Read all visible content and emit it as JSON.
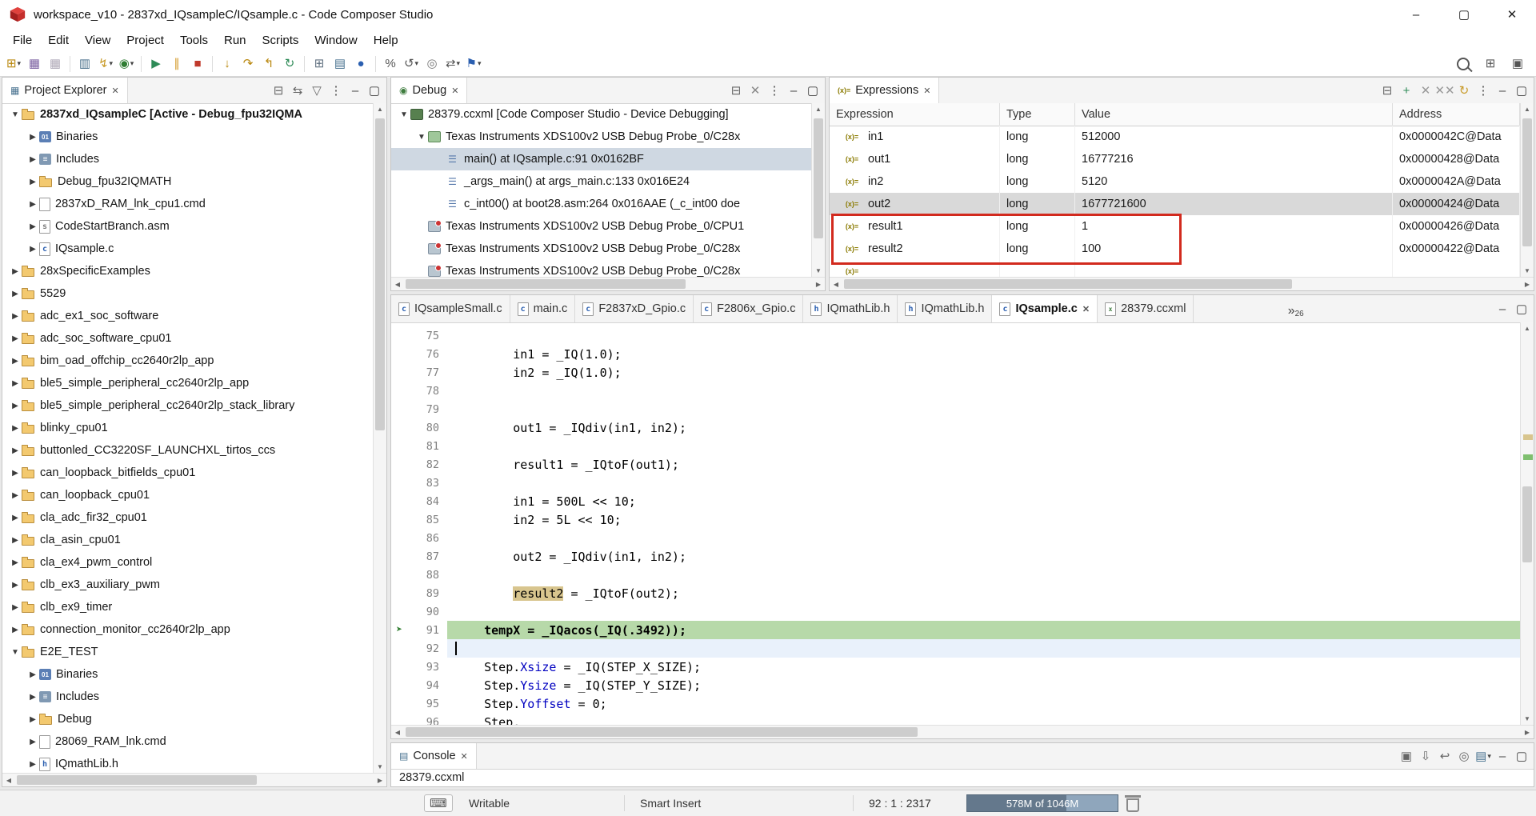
{
  "window": {
    "title": "workspace_v10 - 2837xd_IQsampleC/IQsample.c - Code Composer Studio",
    "controls": {
      "minimize": "–",
      "maximize": "▢",
      "close": "✕"
    }
  },
  "menubar": {
    "items": [
      "File",
      "Edit",
      "View",
      "Project",
      "Tools",
      "Run",
      "Scripts",
      "Window",
      "Help"
    ]
  },
  "toolbar": {
    "left": [
      {
        "name": "new",
        "glyph": "⊞",
        "color": "#b8860b",
        "dropdown": true
      },
      {
        "name": "save",
        "glyph": "▦",
        "color": "#7a5fa0"
      },
      {
        "name": "save-all",
        "glyph": "▦",
        "color": "#b0aab8"
      },
      {
        "sep": true
      },
      {
        "name": "new-target-configuration",
        "glyph": "▥",
        "color": "#4a708b"
      },
      {
        "name": "flash",
        "glyph": "↯",
        "color": "#c89b2a",
        "dropdown": true
      },
      {
        "name": "debug",
        "glyph": "◉",
        "color": "#2e7d32",
        "dropdown": true
      },
      {
        "sep": true
      },
      {
        "name": "resume",
        "glyph": "▶",
        "color": "#2e8b57"
      },
      {
        "name": "suspend",
        "glyph": "∥",
        "color": "#d49a2a"
      },
      {
        "name": "terminate",
        "glyph": "■",
        "color": "#c0392b"
      },
      {
        "sep": true
      },
      {
        "name": "step-into",
        "glyph": "↓",
        "color": "#b8860b"
      },
      {
        "name": "step-over",
        "glyph": "↷",
        "color": "#b8860b"
      },
      {
        "name": "step-return",
        "glyph": "↰",
        "color": "#b8860b"
      },
      {
        "name": "restart",
        "glyph": "↻",
        "color": "#2e8b57"
      },
      {
        "sep": true
      },
      {
        "name": "registers",
        "glyph": "⊞",
        "color": "#5f6f7f"
      },
      {
        "name": "memory-browser",
        "glyph": "▤",
        "color": "#46708e"
      },
      {
        "name": "breakpoints",
        "glyph": "●",
        "color": "#2b5fb0"
      },
      {
        "sep": true
      },
      {
        "name": "profile",
        "glyph": "%",
        "color": "#555555"
      },
      {
        "name": "reset-cpu",
        "glyph": "↺",
        "color": "#555555",
        "dropdown": true
      },
      {
        "name": "pin",
        "glyph": "◎",
        "color": "#777777"
      },
      {
        "name": "connect-target",
        "glyph": "⇄",
        "color": "#555555",
        "dropdown": true
      },
      {
        "name": "new-breakpoint",
        "glyph": "⚑",
        "color": "#2b5fb0",
        "dropdown": true
      }
    ],
    "right": [
      {
        "name": "search",
        "mag": true
      },
      {
        "name": "open-perspective",
        "glyph": "⊞",
        "color": "#555555"
      },
      {
        "name": "ccs-debug-perspective",
        "glyph": "▣",
        "color": "#555555"
      }
    ]
  },
  "project_explorer": {
    "title": "Project Explorer",
    "tab_glyph": "▦",
    "header_icons": [
      {
        "name": "collapse-all",
        "glyph": "⊟",
        "color": "#666666"
      },
      {
        "name": "link-with-editor",
        "glyph": "⇆",
        "color": "#666666"
      },
      {
        "name": "filter",
        "glyph": "▽",
        "color": "#666666"
      },
      {
        "name": "view-menu",
        "glyph": "⋮",
        "color": "#444444"
      },
      {
        "name": "minimize",
        "glyph": "–",
        "color": "#444444"
      },
      {
        "name": "maximize",
        "glyph": "▢",
        "color": "#444444"
      }
    ],
    "items": [
      {
        "label": "2837xd_IQsampleC  [Active - Debug_fpu32IQMA",
        "depth": 0,
        "state": "open",
        "icon": "project",
        "bold": true
      },
      {
        "label": "Binaries",
        "depth": 1,
        "state": "closed",
        "icon": "binaries"
      },
      {
        "label": "Includes",
        "depth": 1,
        "state": "closed",
        "icon": "includes"
      },
      {
        "label": "Debug_fpu32IQMATH",
        "depth": 1,
        "state": "closed",
        "icon": "folder"
      },
      {
        "label": "2837xD_RAM_lnk_cpu1.cmd",
        "depth": 1,
        "state": "closed",
        "icon": "cmdfile"
      },
      {
        "label": "CodeStartBranch.asm",
        "depth": 1,
        "state": "closed",
        "icon": "asmfile"
      },
      {
        "label": "IQsample.c",
        "depth": 1,
        "state": "closed",
        "icon": "cfile"
      },
      {
        "label": "28xSpecificExamples",
        "depth": 0,
        "state": "closed",
        "icon": "project"
      },
      {
        "label": "5529",
        "depth": 0,
        "state": "closed",
        "icon": "project"
      },
      {
        "label": "adc_ex1_soc_software",
        "depth": 0,
        "state": "closed",
        "icon": "project"
      },
      {
        "label": "adc_soc_software_cpu01",
        "depth": 0,
        "state": "closed",
        "icon": "project"
      },
      {
        "label": "bim_oad_offchip_cc2640r2lp_app",
        "depth": 0,
        "state": "closed",
        "icon": "project"
      },
      {
        "label": "ble5_simple_peripheral_cc2640r2lp_app",
        "depth": 0,
        "state": "closed",
        "icon": "project"
      },
      {
        "label": "ble5_simple_peripheral_cc2640r2lp_stack_library",
        "depth": 0,
        "state": "closed",
        "icon": "project"
      },
      {
        "label": "blinky_cpu01",
        "depth": 0,
        "state": "closed",
        "icon": "project"
      },
      {
        "label": "buttonled_CC3220SF_LAUNCHXL_tirtos_ccs",
        "depth": 0,
        "state": "closed",
        "icon": "project"
      },
      {
        "label": "can_loopback_bitfields_cpu01",
        "depth": 0,
        "state": "closed",
        "icon": "project"
      },
      {
        "label": "can_loopback_cpu01",
        "depth": 0,
        "state": "closed",
        "icon": "project"
      },
      {
        "label": "cla_adc_fir32_cpu01",
        "depth": 0,
        "state": "closed",
        "icon": "project"
      },
      {
        "label": "cla_asin_cpu01",
        "depth": 0,
        "state": "closed",
        "icon": "project"
      },
      {
        "label": "cla_ex4_pwm_control",
        "depth": 0,
        "state": "closed",
        "icon": "project"
      },
      {
        "label": "clb_ex3_auxiliary_pwm",
        "depth": 0,
        "state": "closed",
        "icon": "project"
      },
      {
        "label": "clb_ex9_timer",
        "depth": 0,
        "state": "closed",
        "icon": "project"
      },
      {
        "label": "connection_monitor_cc2640r2lp_app",
        "depth": 0,
        "state": "closed",
        "icon": "project"
      },
      {
        "label": "E2E_TEST",
        "depth": 0,
        "state": "open",
        "icon": "project"
      },
      {
        "label": "Binaries",
        "depth": 1,
        "state": "closed",
        "icon": "binaries"
      },
      {
        "label": "Includes",
        "depth": 1,
        "state": "closed",
        "icon": "includes"
      },
      {
        "label": "Debug",
        "depth": 1,
        "state": "closed",
        "icon": "folder"
      },
      {
        "label": "28069_RAM_lnk.cmd",
        "depth": 1,
        "state": "closed",
        "icon": "cmdfile"
      },
      {
        "label": "IQmathLib.h",
        "depth": 1,
        "state": "closed",
        "icon": "hfile"
      }
    ]
  },
  "debug_panel": {
    "title": "Debug",
    "tab_glyph": "◉",
    "header_icons": [
      {
        "name": "collapse-all",
        "glyph": "⊟",
        "color": "#666666"
      },
      {
        "name": "remove-all-terminated",
        "glyph": "✕",
        "color": "#888888"
      },
      {
        "name": "view-menu",
        "glyph": "⋮",
        "color": "#444444"
      },
      {
        "name": "minimize",
        "glyph": "–",
        "color": "#444444"
      },
      {
        "name": "maximize",
        "glyph": "▢",
        "color": "#444444"
      }
    ],
    "items": [
      {
        "label": "28379.ccxml [Code Composer Studio - Device Debugging]",
        "depth": 0,
        "state": "open",
        "icon": "target"
      },
      {
        "label": "Texas Instruments XDS100v2 USB Debug Probe_0/C28x",
        "depth": 1,
        "state": "open",
        "icon": "corerun"
      },
      {
        "label": "main() at IQsample.c:91 0x0162BF",
        "depth": 2,
        "icon": "frame",
        "selected": true
      },
      {
        "label": "_args_main() at args_main.c:133 0x016E24",
        "depth": 2,
        "icon": "frame"
      },
      {
        "label": "c_int00() at boot28.asm:264 0x016AAE (_c_int00 doe",
        "depth": 2,
        "icon": "frame"
      },
      {
        "label": "Texas Instruments XDS100v2 USB Debug Probe_0/CPU1",
        "depth": 1,
        "icon": "core"
      },
      {
        "label": "Texas Instruments XDS100v2 USB Debug Probe_0/C28x",
        "depth": 1,
        "icon": "core"
      },
      {
        "label": "Texas Instruments XDS100v2 USB Debug Probe_0/C28x",
        "depth": 1,
        "icon": "core"
      }
    ]
  },
  "expressions": {
    "title": "Expressions",
    "tab_glyph": "(x)=",
    "header_icons": [
      {
        "name": "collapse-all",
        "glyph": "⊟",
        "color": "#666666"
      },
      {
        "name": "add-expression",
        "glyph": "+",
        "color": "#2e8b57"
      },
      {
        "name": "remove-expression",
        "glyph": "✕",
        "color": "#999999"
      },
      {
        "name": "remove-all-expressions",
        "glyph": "✕✕",
        "color": "#999999"
      },
      {
        "name": "refresh",
        "glyph": "↻",
        "color": "#c89b2a"
      },
      {
        "name": "view-menu",
        "glyph": "⋮",
        "color": "#444444"
      },
      {
        "name": "minimize",
        "glyph": "–",
        "color": "#444444"
      },
      {
        "name": "maximize",
        "glyph": "▢",
        "color": "#444444"
      }
    ],
    "columns": [
      "Expression",
      "Type",
      "Value",
      "Address"
    ],
    "rows": [
      {
        "name": "in1",
        "type": "long",
        "value": "512000",
        "address": "0x0000042C@Data"
      },
      {
        "name": "out1",
        "type": "long",
        "value": "16777216",
        "address": "0x00000428@Data"
      },
      {
        "name": "in2",
        "type": "long",
        "value": "5120",
        "address": "0x0000042A@Data"
      },
      {
        "name": "out2",
        "type": "long",
        "value": "1677721600",
        "address": "0x00000424@Data",
        "selected": true
      },
      {
        "name": "result1",
        "type": "long",
        "value": "1",
        "address": "0x00000426@Data",
        "highlighted": true
      },
      {
        "name": "result2",
        "type": "long",
        "value": "100",
        "address": "0x00000422@Data",
        "highlighted": true
      }
    ]
  },
  "editor": {
    "hidden_count": "26",
    "header_icons": [
      {
        "name": "minimize",
        "glyph": "–",
        "color": "#444444"
      },
      {
        "name": "maximize",
        "glyph": "▢",
        "color": "#444444"
      }
    ],
    "tabs": [
      {
        "label": "IQsampleSmall.c",
        "icon": "cfile"
      },
      {
        "label": "main.c",
        "icon": "cfile"
      },
      {
        "label": "F2837xD_Gpio.c",
        "icon": "cfile"
      },
      {
        "label": "F2806x_Gpio.c",
        "icon": "cfile"
      },
      {
        "label": "IQmathLib.h",
        "icon": "hfile"
      },
      {
        "label": "IQmathLib.h",
        "icon": "hfile"
      },
      {
        "label": "IQsample.c",
        "icon": "cfile",
        "active": true
      },
      {
        "label": "28379.ccxml",
        "icon": "ccxml"
      }
    ],
    "lines": [
      {
        "num": "75",
        "segs": []
      },
      {
        "num": "76",
        "segs": [
          {
            "t": "        in1 = _IQ(1.0);"
          }
        ]
      },
      {
        "num": "77",
        "segs": [
          {
            "t": "        in2 = _IQ(1.0);"
          }
        ]
      },
      {
        "num": "78",
        "segs": []
      },
      {
        "num": "79",
        "segs": []
      },
      {
        "num": "80",
        "segs": [
          {
            "t": "        out1 = _IQdiv(in1, in2);"
          }
        ]
      },
      {
        "num": "81",
        "segs": []
      },
      {
        "num": "82",
        "segs": [
          {
            "t": "        result1 = _IQtoF(out1);"
          }
        ]
      },
      {
        "num": "83",
        "segs": []
      },
      {
        "num": "84",
        "segs": [
          {
            "t": "        in1 = 500L << 10;"
          }
        ]
      },
      {
        "num": "85",
        "segs": [
          {
            "t": "        in2 = 5L << 10;"
          }
        ]
      },
      {
        "num": "86",
        "segs": []
      },
      {
        "num": "87",
        "segs": [
          {
            "t": "        out2 = _IQdiv(in1, in2);"
          }
        ]
      },
      {
        "num": "88",
        "segs": []
      },
      {
        "num": "89",
        "segs": [
          {
            "t": "        "
          },
          {
            "t": "result2",
            "occ": true
          },
          {
            "t": " = _IQtoF(out2);"
          }
        ]
      },
      {
        "num": "90",
        "segs": []
      },
      {
        "num": "91",
        "hl": "debug",
        "pointer": true,
        "segs": [
          {
            "t": "    tempX = _IQacos(_IQ(.3492));"
          }
        ]
      },
      {
        "num": "92",
        "hl": "cursor",
        "segs": []
      },
      {
        "num": "93",
        "segs": [
          {
            "t": "    Step."
          },
          {
            "t": "Xsize",
            "c": "member"
          },
          {
            "t": " = _IQ(STEP_X_SIZE);"
          }
        ]
      },
      {
        "num": "94",
        "segs": [
          {
            "t": "    Step."
          },
          {
            "t": "Ysize",
            "c": "member"
          },
          {
            "t": " = _IQ(STEP_Y_SIZE);"
          }
        ]
      },
      {
        "num": "95",
        "segs": [
          {
            "t": "    Step."
          },
          {
            "t": "Yoffset",
            "c": "member"
          },
          {
            "t": " = 0;"
          }
        ]
      },
      {
        "num": "96",
        "segs": [
          {
            "t": "    Step."
          }
        ]
      }
    ]
  },
  "console": {
    "title": "Console",
    "tab_glyph": "▤",
    "content": "28379.ccxml",
    "header_icons": [
      {
        "name": "clear-console",
        "glyph": "▣",
        "color": "#666666"
      },
      {
        "name": "scroll-lock",
        "glyph": "⇩",
        "color": "#666666"
      },
      {
        "name": "word-wrap",
        "glyph": "↩",
        "color": "#666666"
      },
      {
        "name": "pin-console",
        "glyph": "◎",
        "color": "#666666"
      },
      {
        "name": "open-console",
        "glyph": "▤",
        "color": "#46708e",
        "dropdown": true
      },
      {
        "name": "minimize",
        "glyph": "–",
        "color": "#444444"
      },
      {
        "name": "maximize",
        "glyph": "▢",
        "color": "#444444"
      }
    ]
  },
  "statusbar": {
    "writable": "Writable",
    "insert_mode": "Smart Insert",
    "position": "92 : 1 : 2317",
    "heap": "578M of 1046M"
  }
}
